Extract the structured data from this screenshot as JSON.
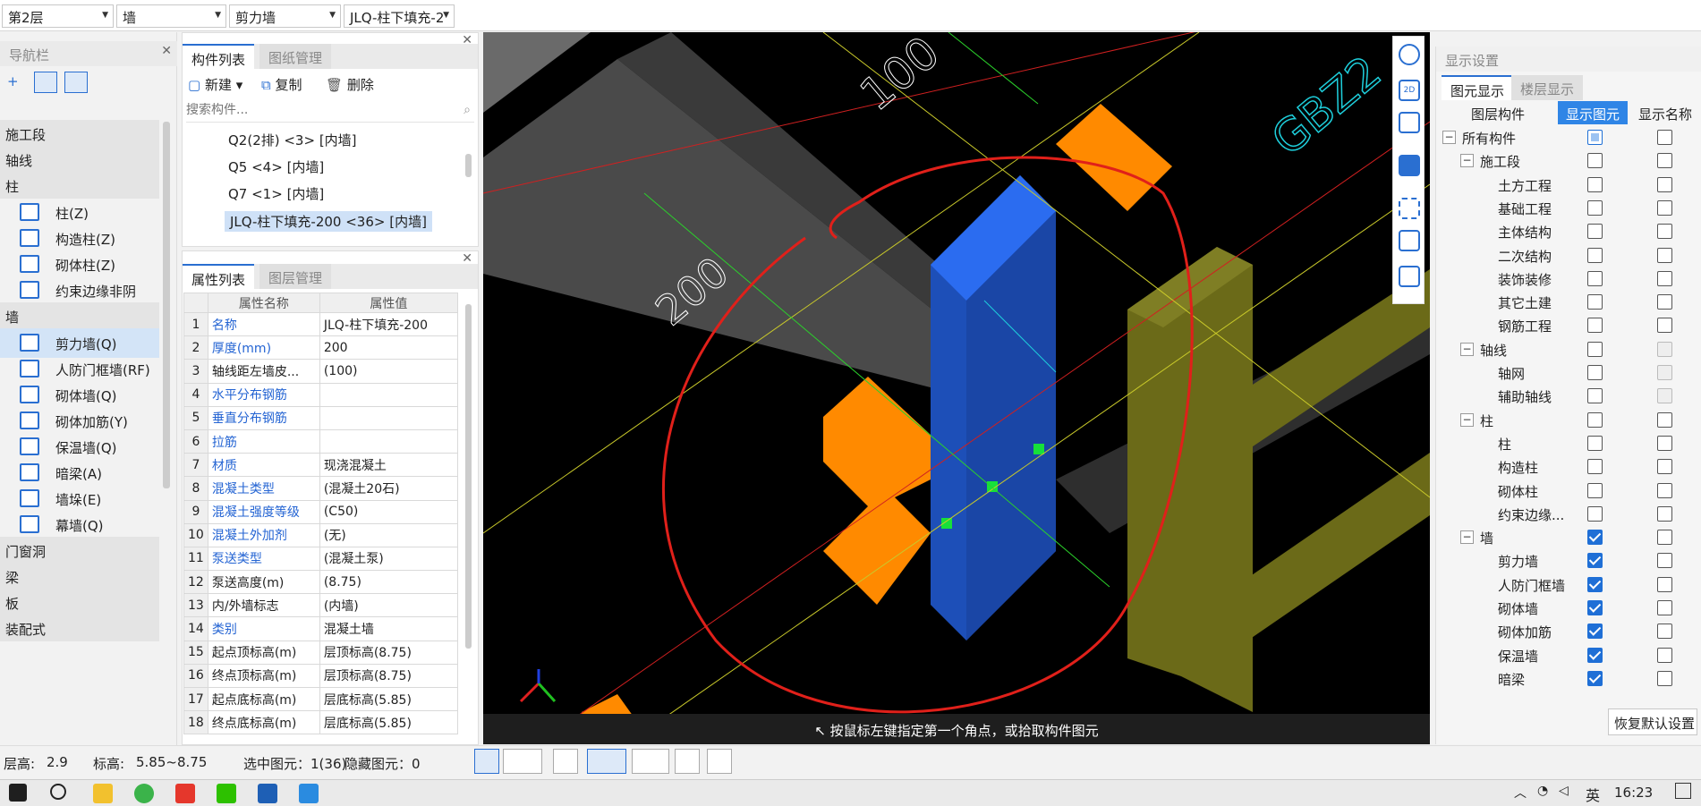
{
  "topbar": {
    "floor": "第2层",
    "category": "墙",
    "type": "剪力墙",
    "component": "JLQ-柱下填充-2"
  },
  "nav": {
    "title": "导航栏",
    "items": [
      {
        "kind": "cat",
        "label": "施工段"
      },
      {
        "kind": "cat",
        "label": "轴线"
      },
      {
        "kind": "cat",
        "label": "柱"
      },
      {
        "kind": "item",
        "label": "柱(Z)",
        "icon": "column-icon"
      },
      {
        "kind": "item",
        "label": "构造柱(Z)",
        "icon": "structural-column-icon"
      },
      {
        "kind": "item",
        "label": "砌体柱(Z)",
        "icon": "masonry-column-icon"
      },
      {
        "kind": "item",
        "label": "约束边缘非阴影...",
        "icon": "edge-constraint-icon"
      },
      {
        "kind": "cat",
        "label": "墙"
      },
      {
        "kind": "item",
        "label": "剪力墙(Q)",
        "icon": "shear-wall-icon",
        "selected": true
      },
      {
        "kind": "item",
        "label": "人防门框墙(RF)",
        "icon": "civil-defense-door-wall-icon"
      },
      {
        "kind": "item",
        "label": "砌体墙(Q)",
        "icon": "masonry-wall-icon"
      },
      {
        "kind": "item",
        "label": "砌体加筋(Y)",
        "icon": "masonry-rebar-icon"
      },
      {
        "kind": "item",
        "label": "保温墙(Q)",
        "icon": "insulation-wall-icon"
      },
      {
        "kind": "item",
        "label": "暗梁(A)",
        "icon": "hidden-beam-icon"
      },
      {
        "kind": "item",
        "label": "墙垛(E)",
        "icon": "wall-pier-icon"
      },
      {
        "kind": "item",
        "label": "幕墙(Q)",
        "icon": "curtain-wall-icon"
      },
      {
        "kind": "cat",
        "label": "门窗洞"
      },
      {
        "kind": "cat",
        "label": "梁"
      },
      {
        "kind": "cat",
        "label": "板"
      },
      {
        "kind": "cat",
        "label": "装配式"
      }
    ]
  },
  "component_list": {
    "tabs": [
      "构件列表",
      "图纸管理"
    ],
    "toolbar": {
      "new": "新建",
      "copy": "复制",
      "delete": "删除"
    },
    "search_placeholder": "搜索构件...",
    "rows": [
      "Q2(2排) <3> [内墙]",
      "Q5 <4> [内墙]",
      "Q7 <1> [内墙]",
      "JLQ-柱下填充-200 <36> [内墙]"
    ],
    "selected_index": 3
  },
  "properties": {
    "tabs": [
      "属性列表",
      "图层管理"
    ],
    "header": {
      "name": "属性名称",
      "value": "属性值"
    },
    "rows": [
      {
        "n": "1",
        "name": "名称",
        "value": "JLQ-柱下填充-200",
        "blue": true
      },
      {
        "n": "2",
        "name": "厚度(mm)",
        "value": "200",
        "blue": true
      },
      {
        "n": "3",
        "name": "轴线距左墙皮...",
        "value": "(100)",
        "blue": false
      },
      {
        "n": "4",
        "name": "水平分布钢筋",
        "value": "",
        "blue": true
      },
      {
        "n": "5",
        "name": "垂直分布钢筋",
        "value": "",
        "blue": true
      },
      {
        "n": "6",
        "name": "拉筋",
        "value": "",
        "blue": true
      },
      {
        "n": "7",
        "name": "材质",
        "value": "现浇混凝土",
        "blue": true
      },
      {
        "n": "8",
        "name": "混凝土类型",
        "value": "(混凝土20石)",
        "blue": true
      },
      {
        "n": "9",
        "name": "混凝土强度等级",
        "value": "(C50)",
        "blue": true
      },
      {
        "n": "10",
        "name": "混凝土外加剂",
        "value": "(无)",
        "blue": true
      },
      {
        "n": "11",
        "name": "泵送类型",
        "value": "(混凝土泵)",
        "blue": true
      },
      {
        "n": "12",
        "name": "泵送高度(m)",
        "value": "(8.75)",
        "blue": false
      },
      {
        "n": "13",
        "name": "内/外墙标志",
        "value": "(内墙)",
        "blue": false
      },
      {
        "n": "14",
        "name": "类别",
        "value": "混凝土墙",
        "blue": true
      },
      {
        "n": "15",
        "name": "起点顶标高(m)",
        "value": "层顶标高(8.75)",
        "blue": false
      },
      {
        "n": "16",
        "name": "终点顶标高(m)",
        "value": "层顶标高(8.75)",
        "blue": false
      },
      {
        "n": "17",
        "name": "起点底标高(m)",
        "value": "层底标高(5.85)",
        "blue": false
      },
      {
        "n": "18",
        "name": "终点底标高(m)",
        "value": "层底标高(5.85)",
        "blue": false
      }
    ]
  },
  "viewport": {
    "hint": "按鼠标左键指定第一个角点，或拾取构件图元",
    "labels": [
      "100",
      "200",
      "GBZ2"
    ],
    "colors": {
      "background": "#000000",
      "selected_wall": "#1f56c8",
      "orange_column": "#ff8a00",
      "olive_beam": "#6b6a18",
      "annotation": "#e0201a"
    }
  },
  "display_settings": {
    "title": "显示设置",
    "tabs": [
      "图元显示",
      "楼层显示"
    ],
    "columns": [
      "图层构件",
      "显示图元",
      "显示名称"
    ],
    "rows": [
      {
        "label": "所有构件",
        "level": 0,
        "expander": true,
        "show": "partial",
        "name": false
      },
      {
        "label": "施工段",
        "level": 1,
        "expander": true,
        "show": false,
        "name": false
      },
      {
        "label": "土方工程",
        "level": 2,
        "show": false,
        "name": false
      },
      {
        "label": "基础工程",
        "level": 2,
        "show": false,
        "name": false
      },
      {
        "label": "主体结构",
        "level": 2,
        "show": false,
        "name": false
      },
      {
        "label": "二次结构",
        "level": 2,
        "show": false,
        "name": false
      },
      {
        "label": "装饰装修",
        "level": 2,
        "show": false,
        "name": false
      },
      {
        "label": "其它土建",
        "level": 2,
        "show": false,
        "name": false
      },
      {
        "label": "钢筋工程",
        "level": 2,
        "show": false,
        "name": false
      },
      {
        "label": "轴线",
        "level": 1,
        "expander": true,
        "show": false,
        "name": "dim"
      },
      {
        "label": "轴网",
        "level": 2,
        "show": false,
        "name": "dim"
      },
      {
        "label": "辅助轴线",
        "level": 2,
        "show": false,
        "name": "dim"
      },
      {
        "label": "柱",
        "level": 1,
        "expander": true,
        "show": false,
        "name": false
      },
      {
        "label": "柱",
        "level": 2,
        "show": false,
        "name": false
      },
      {
        "label": "构造柱",
        "level": 2,
        "show": false,
        "name": false
      },
      {
        "label": "砌体柱",
        "level": 2,
        "show": false,
        "name": false
      },
      {
        "label": "约束边缘...",
        "level": 2,
        "show": false,
        "name": false
      },
      {
        "label": "墙",
        "level": 1,
        "expander": true,
        "show": true,
        "name": false
      },
      {
        "label": "剪力墙",
        "level": 2,
        "show": true,
        "name": false
      },
      {
        "label": "人防门框墙",
        "level": 2,
        "show": true,
        "name": false
      },
      {
        "label": "砌体墙",
        "level": 2,
        "show": true,
        "name": false
      },
      {
        "label": "砌体加筋",
        "level": 2,
        "show": true,
        "name": false
      },
      {
        "label": "保温墙",
        "level": 2,
        "show": true,
        "name": false
      },
      {
        "label": "暗梁",
        "level": 2,
        "show": true,
        "name": false
      }
    ],
    "restore_button": "恢复默认设置"
  },
  "status": {
    "floor_height": "层高:",
    "floor_height_value": "2.9",
    "elevation": "标高:",
    "elevation_value": "5.85~8.75",
    "selected": "选中图元：1(36)",
    "hidden": "隐藏图元：0"
  },
  "taskbar": {
    "ime": "英",
    "time": "16:23"
  }
}
